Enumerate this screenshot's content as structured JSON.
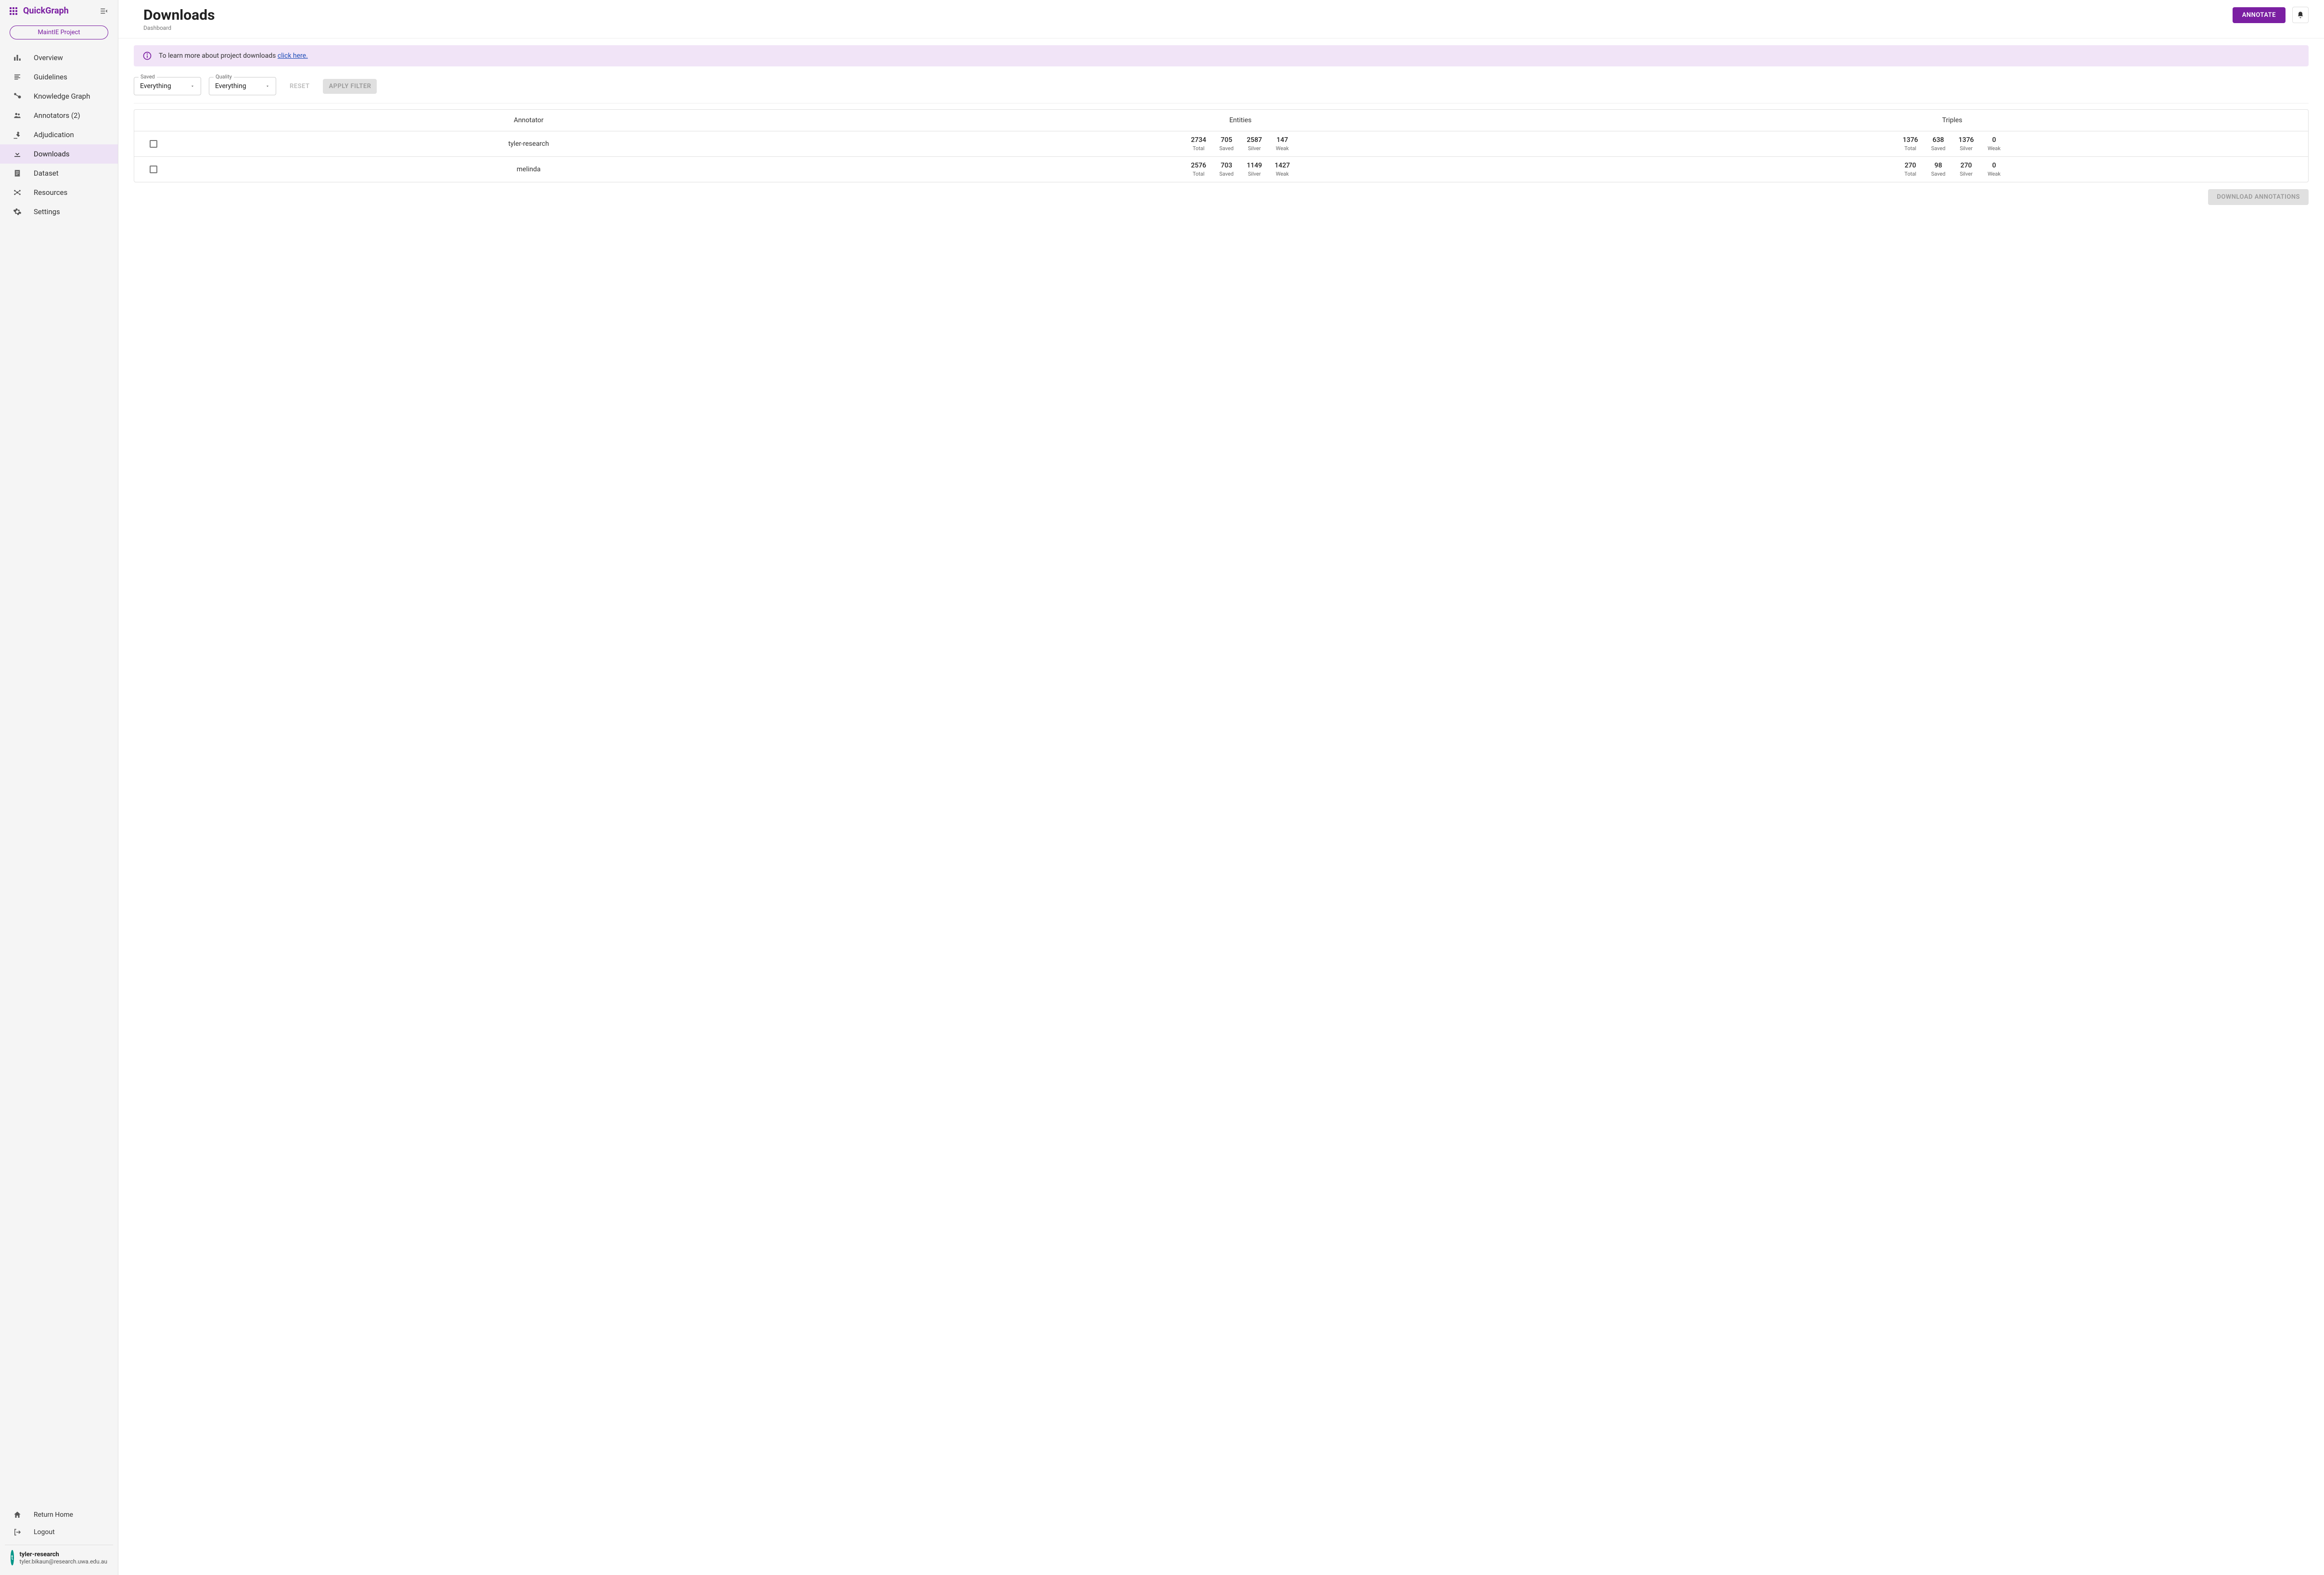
{
  "brand": "QuickGraph",
  "project_chip": "MaintIE Project",
  "sidebar": {
    "items": [
      {
        "label": "Overview"
      },
      {
        "label": "Guidelines"
      },
      {
        "label": "Knowledge Graph"
      },
      {
        "label": "Annotators (2)"
      },
      {
        "label": "Adjudication"
      },
      {
        "label": "Downloads"
      },
      {
        "label": "Dataset"
      },
      {
        "label": "Resources"
      },
      {
        "label": "Settings"
      }
    ],
    "return_home": "Return Home",
    "logout": "Logout"
  },
  "user": {
    "initial": "t",
    "name": "tyler-research",
    "email": "tyler.bikaun@research.uwa.edu.au"
  },
  "header": {
    "title": "Downloads",
    "breadcrumb": "Dashboard",
    "annotate": "ANNOTATE"
  },
  "alert": {
    "text": "To learn more about project downloads ",
    "link": "click here."
  },
  "filters": {
    "saved_legend": "Saved",
    "saved_value": "Everything",
    "quality_legend": "Quality",
    "quality_value": "Everything",
    "reset": "RESET",
    "apply": "APPLY FILTER"
  },
  "table": {
    "headers": {
      "annotator": "Annotator",
      "entities": "Entities",
      "triples": "Triples"
    },
    "stat_labels": {
      "total": "Total",
      "saved": "Saved",
      "silver": "Silver",
      "weak": "Weak"
    },
    "rows": [
      {
        "annotator": "tyler-research",
        "entities": {
          "total": "2734",
          "saved": "705",
          "silver": "2587",
          "weak": "147"
        },
        "triples": {
          "total": "1376",
          "saved": "638",
          "silver": "1376",
          "weak": "0"
        }
      },
      {
        "annotator": "melinda",
        "entities": {
          "total": "2576",
          "saved": "703",
          "silver": "1149",
          "weak": "1427"
        },
        "triples": {
          "total": "270",
          "saved": "98",
          "silver": "270",
          "weak": "0"
        }
      }
    ]
  },
  "download_button": "DOWNLOAD ANNOTATIONS"
}
